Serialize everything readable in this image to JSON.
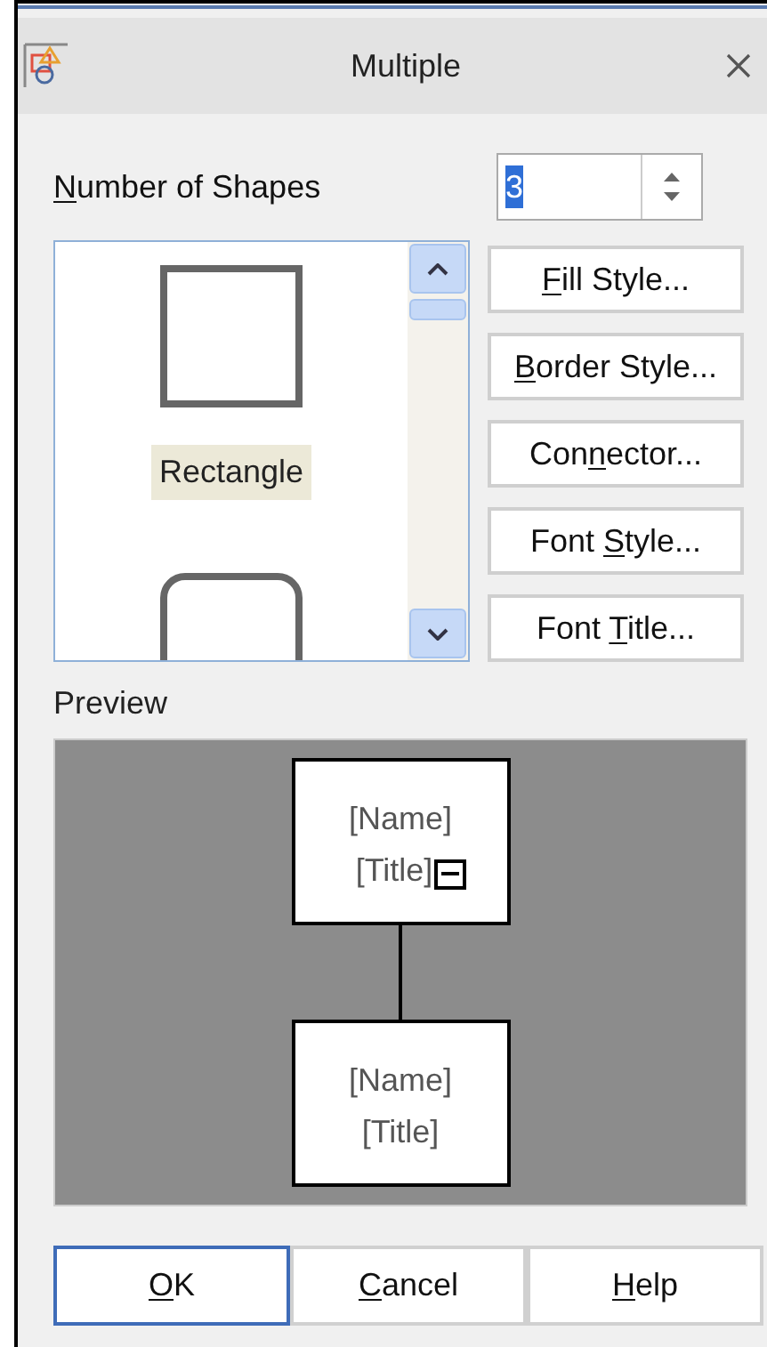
{
  "window": {
    "title": "Multiple"
  },
  "number_of_shapes": {
    "label": {
      "key": "N",
      "post": "umber of Shapes"
    },
    "value": "3"
  },
  "shape_list": {
    "items": [
      {
        "kind": "rectangle",
        "label": "Rectangle",
        "selected": true
      },
      {
        "kind": "rounded",
        "selected": false
      }
    ]
  },
  "side_buttons": [
    {
      "label": {
        "key": "F",
        "post": "ill Style..."
      }
    },
    {
      "label": {
        "key": "B",
        "post": "order Style..."
      }
    },
    {
      "label": {
        "pre": "Con",
        "key": "n",
        "post": "ector..."
      }
    },
    {
      "label": {
        "pre": "Font ",
        "key": "S",
        "post": "tyle..."
      }
    },
    {
      "label": {
        "pre": "Font ",
        "key": "T",
        "post": "itle..."
      }
    }
  ],
  "preview": {
    "label": "Preview",
    "nodes": [
      {
        "name": "[Name]",
        "title": "[Title]",
        "collapsible": true
      },
      {
        "name": "[Name]",
        "title": "[Title]",
        "collapsible": false
      }
    ]
  },
  "buttons": [
    {
      "label": {
        "key": "O",
        "post": "K"
      },
      "default": true
    },
    {
      "label": {
        "key": "C",
        "post": "ancel"
      },
      "default": false
    },
    {
      "label": {
        "key": "H",
        "post": "elp"
      },
      "default": false
    }
  ]
}
